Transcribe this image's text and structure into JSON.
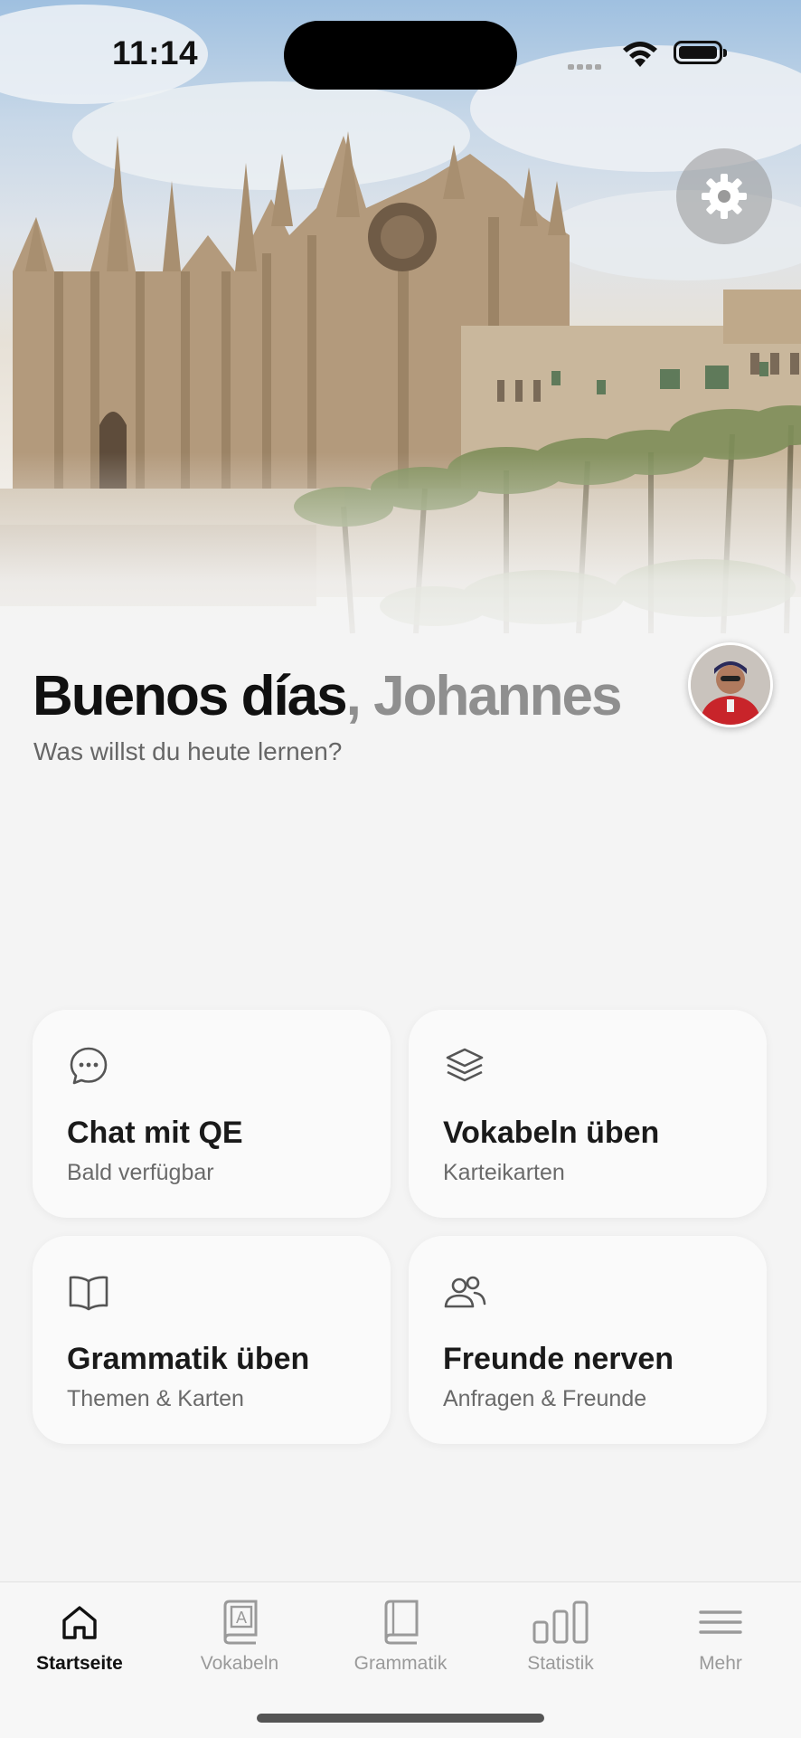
{
  "status_bar": {
    "time": "11:14"
  },
  "header": {
    "greeting": "Buenos días",
    "name": ", Johannes",
    "subtitle": "Was willst du heute lernen?",
    "settings_icon": "gear-icon"
  },
  "cards": [
    {
      "icon": "chat-bubble-icon",
      "title": "Chat mit QE",
      "subtitle": "Bald verfügbar"
    },
    {
      "icon": "layers-icon",
      "title": "Vokabeln üben",
      "subtitle": "Karteikarten"
    },
    {
      "icon": "open-book-icon",
      "title": "Grammatik üben",
      "subtitle": "Themen & Karten"
    },
    {
      "icon": "people-icon",
      "title": "Freunde nerven",
      "subtitle": "Anfragen & Freunde"
    }
  ],
  "tabbar": {
    "active": "Startseite",
    "items": [
      {
        "label": "Startseite",
        "icon": "home-icon"
      },
      {
        "label": "Vokabeln",
        "icon": "vocab-book-icon"
      },
      {
        "label": "Grammatik",
        "icon": "book-icon"
      },
      {
        "label": "Statistik",
        "icon": "bar-chart-icon"
      },
      {
        "label": "Mehr",
        "icon": "menu-icon"
      }
    ]
  }
}
